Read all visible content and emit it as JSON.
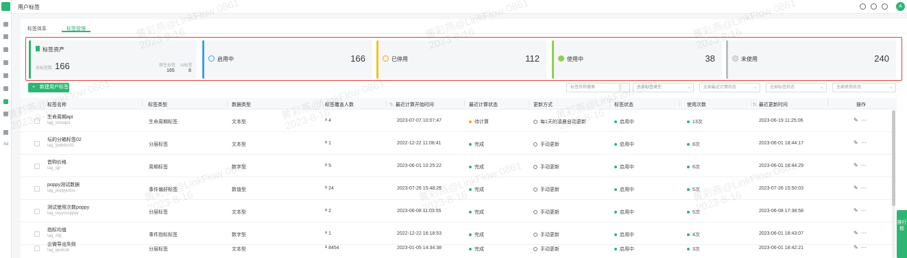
{
  "header": {
    "title": "用户标签",
    "avatar_initial": "A"
  },
  "tabs": [
    {
      "label": "标签体系"
    },
    {
      "label": "标签管理"
    }
  ],
  "asset_card": {
    "title": "标签资产",
    "total_label": "总标签数",
    "total_value": "166",
    "sub": [
      {
        "label": "原生标签",
        "value": "165"
      },
      {
        "label": "AI标签",
        "value": "8"
      }
    ]
  },
  "stat_cards": [
    {
      "label": "启用中",
      "value": "166",
      "color": "#3aa0e8",
      "icon": "check-circle-icon"
    },
    {
      "label": "已停用",
      "value": "112",
      "color": "#f0c419",
      "icon": "pause-circle-icon"
    },
    {
      "label": "使用中",
      "value": "38",
      "color": "#8fd14f",
      "icon": "in-use-icon"
    },
    {
      "label": "未使用",
      "value": "240",
      "color": "#bdbdbd",
      "icon": "unused-icon"
    }
  ],
  "toolbar": {
    "new_button": "新建用户标签",
    "search_placeholder": "标签名称搜索",
    "filters": [
      "全部标签类型",
      "全部最近计算状态",
      "全部标签状态",
      "全部使用状态"
    ]
  },
  "table": {
    "columns": [
      "标签名称",
      "标签类型",
      "数据类型",
      "标签覆盖人数",
      "最近计算开始时间",
      "最近计算状态",
      "更新方式",
      "标签状态",
      "使用次数",
      "最近更新时间",
      "操作"
    ],
    "rows": [
      {
        "name": "生命周期api",
        "code": "tag_smsapi1",
        "type": "生命周期标签",
        "data_type": "文本型",
        "people": "4",
        "calc_start": "2023-07-07 10:07:47",
        "calc_status": "待计算",
        "calc_state": "warn",
        "update": "每1天的凌晨自动更新",
        "status": "启用中",
        "uses": "13次",
        "updated": "2023-06-19 11:25:06"
      },
      {
        "name": "坛的分箱标签02",
        "code": "tag_fpdbdcc02",
        "type": "分层标签",
        "data_type": "文本型",
        "people": "1",
        "calc_start": "2022-12-22 11:08:41",
        "calc_status": "完成",
        "calc_state": "ok",
        "update": "手动更新",
        "status": "启用中",
        "uses": "8次",
        "updated": "2023-06-01 18:44:17"
      },
      {
        "name": "首购价格",
        "code": "tag_sjjr",
        "type": "周期标签",
        "data_type": "数字型",
        "people": "5",
        "calc_start": "2023-06-01 10:25:22",
        "calc_status": "完成",
        "calc_state": "ok",
        "update": "手动更新",
        "status": "启用中",
        "uses": "6次",
        "updated": "2023-06-01 18:44:29"
      },
      {
        "name": "poppy测试数据",
        "code": "tag_poppycdsu",
        "type": "事件偏好标签",
        "data_type": "数值型",
        "people": "24",
        "calc_start": "2023-07-26 15:48:26",
        "calc_status": "完成",
        "calc_state": "ok",
        "update": "手动更新",
        "status": "启用中",
        "uses": "5次",
        "updated": "2023-07-26 15:50:03"
      },
      {
        "name": "测试使用次数poppy",
        "code": "tag_csyycscpppy",
        "type": "分层标签",
        "data_type": "文本型",
        "people": "2",
        "calc_start": "2023-06-08 11:03:55",
        "calc_status": "完成",
        "calc_state": "ok",
        "update": "手动更新",
        "status": "启用中",
        "uses": "5次",
        "updated": "2023-06-08 17:38:58"
      },
      {
        "name": "指标均值",
        "code": "tag_zbjj",
        "type": "事件指标标签",
        "data_type": "数字型",
        "people": "1",
        "calc_start": "2022-12-22 16:18:53",
        "calc_status": "完成",
        "calc_state": "ok",
        "update": "手动更新",
        "status": "启用中",
        "uses": "4次",
        "updated": "2023-06-01 18:43:07"
      },
      {
        "name": "企微导出失败",
        "code": "tag_qwdcsb",
        "type": "分层标签",
        "data_type": "文本型",
        "people": "8454",
        "calc_start": "2023-01-05 14:34:38",
        "calc_status": "完成",
        "calc_state": "ok",
        "update": "手动更新",
        "status": "启用中",
        "uses": "3次",
        "updated": "2023-06-01 18:42:21"
      }
    ]
  },
  "rank_badge": "排行榜",
  "watermark": {
    "line1": "黄彩燕@LinkFlow 0861",
    "line2": "2023-8-16"
  }
}
